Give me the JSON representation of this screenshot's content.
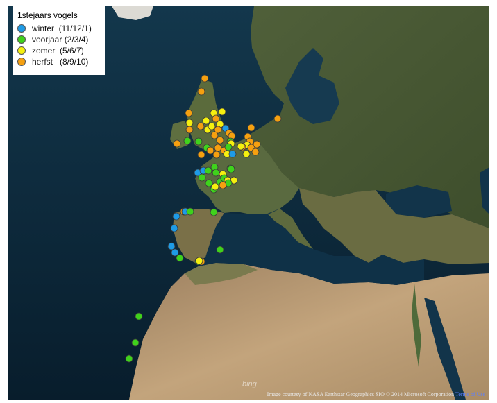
{
  "legend": {
    "title": "1stejaars vogels",
    "items": [
      {
        "label": "winter  (11/12/1)",
        "color": "#1e9be6"
      },
      {
        "label": "voorjaar (2/3/4)",
        "color": "#3fd21c"
      },
      {
        "label": "zomer  (5/6/7)",
        "color": "#f5f00f"
      },
      {
        "label": "herfst   (8/9/10)",
        "color": "#f5a010"
      }
    ]
  },
  "attribution": {
    "text": "Image courtesy of NASA Earthstar Geographics SIO © 2014 Microsoft Corporation ",
    "terms_link": "Terms of Use"
  },
  "bing_logo": "bing",
  "colors": {
    "sea": "#0d2a3c",
    "land_north": "#4a5a32",
    "land_desert": "#b89a72"
  }
}
